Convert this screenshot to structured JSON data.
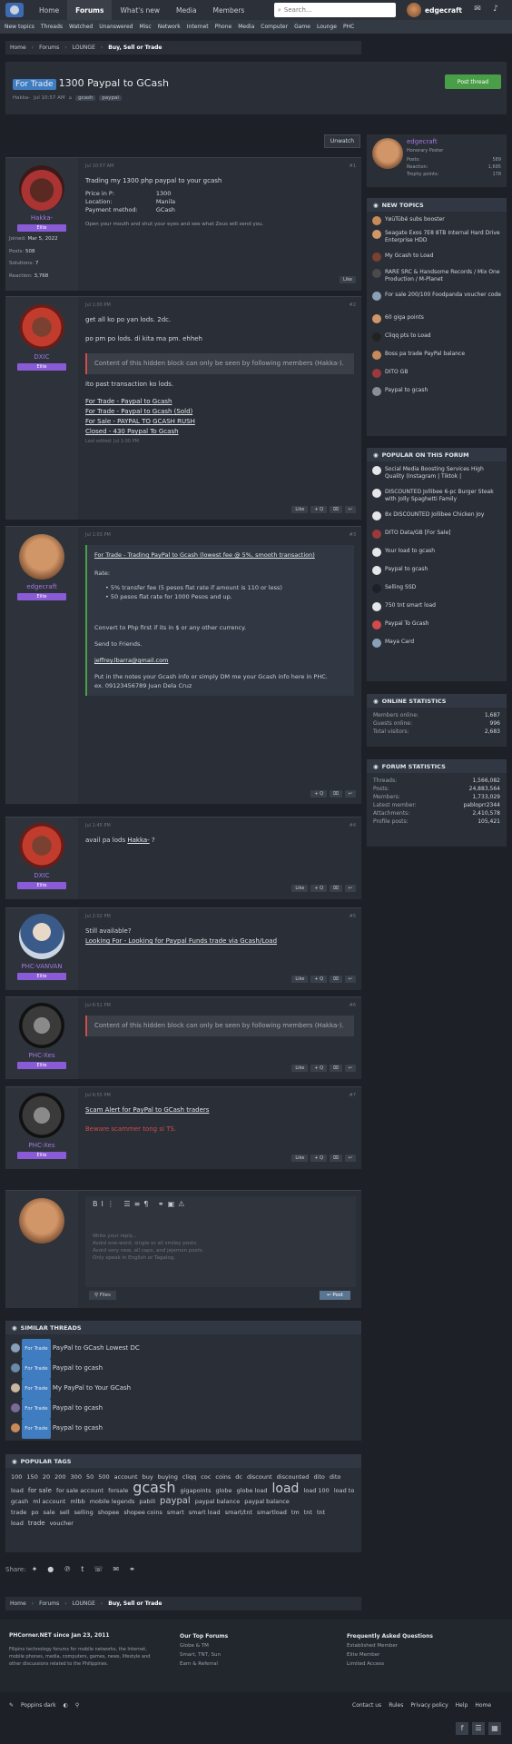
{
  "nav": {
    "tabs": [
      "Home",
      "Forums",
      "What's new",
      "Media",
      "Members"
    ],
    "search_placeholder": "Search...",
    "username": "edgecraft"
  },
  "subnav": [
    "New topics",
    "Threads",
    "Watched",
    "Unanswered",
    "Misc",
    "Network",
    "Internet",
    "Phone",
    "Media",
    "Computer",
    "Game",
    "Lounge",
    "PHC"
  ],
  "breadcrumb": [
    "Home",
    "Forums",
    "LOUNGE",
    "Buy, Sell or Trade"
  ],
  "thread": {
    "prefix": "For Trade",
    "title": "1300 Paypal to GCash",
    "author": "Hakka-",
    "date": "Jul 10:57 AM",
    "tags": [
      "gcash",
      "paypal"
    ],
    "post_button": "Post thread",
    "unwatch": "Unwatch"
  },
  "posts": [
    {
      "user": "Hakka-",
      "badge": "Elite",
      "joined_label": "Joined:",
      "joined": "Mar 5, 2022",
      "posts_label": "Posts:",
      "posts": "508",
      "solutions_label": "Solutions:",
      "solutions": "7",
      "reaction_label": "Reaction:",
      "reaction": "3,768",
      "date": "Jul 10:57 AM",
      "num": "#1",
      "lines": [
        "Trading my 1300 php paypal to your gcash"
      ],
      "fields": [
        [
          "Price in P:",
          "1300"
        ],
        [
          "Location:",
          "Manila"
        ],
        [
          "Payment method:",
          "GCash"
        ]
      ],
      "note": "Open your mouth and shut your eyes and see what Zeus will send you."
    },
    {
      "user": "DXIC",
      "badge": "Elite",
      "date": "Jul 1:00 PM",
      "num": "#2",
      "lines": [
        "get all ko po yan lods. 2dc.",
        "po pm po lods. di kita ma pm. ehheh"
      ],
      "hidden": "Content of this hidden block can only be seen by following members (Hakka-).",
      "after": "ito past transaction ko lods.",
      "links": [
        "For Trade - Paypal to Gcash",
        "For Trade - Paypal to Gcash (Sold)",
        "For Sale - PAYPAL TO GCASH RUSH",
        "Closed - 430 Paypal To Gcash"
      ],
      "edited": "Last edited: Jul 1:00 PM"
    },
    {
      "user": "edgecraft",
      "badge": "Elite",
      "date": "Jul 1:03 PM",
      "num": "#3",
      "quote_title": "For Trade - Trading PayPal to Gcash (lowest fee @ 5%, smooth transaction)",
      "rate_label": "Rate:",
      "bullets": [
        "5% transfer fee (5 pesos flat rate if amount is 110 or less)",
        "50 pesos flat rate for 1000 Pesos and up."
      ],
      "convert": "Convert to Php first if its in $ or any other currency.",
      "send": "Send to Friends.",
      "email": "jeffrey.lbarra@gmail.com",
      "put": "Put in the notes your Gcash info or simply DM me your Gcash info here in PHC.",
      "ex": "ex. 09123456789 Juan Dela Cruz"
    },
    {
      "user": "DXIC",
      "badge": "Elite",
      "date": "Jul 1:45 PM",
      "num": "#4",
      "text": "avail pa lods",
      "mention": "Hakka-",
      "q": "?"
    },
    {
      "user": "PHC-VANVAN",
      "badge": "Elite",
      "date": "Jul 2:02 PM",
      "num": "#5",
      "text": "Still available?",
      "link": "Looking For - Looking for Paypal Funds trade via Gcash/Load"
    },
    {
      "user": "PHC-Xes",
      "badge": "Elite",
      "date": "Jul 6:51 PM",
      "num": "#6",
      "hidden": "Content of this hidden block can only be seen by following members (Hakka-)."
    },
    {
      "user": "PHC-Xes",
      "badge": "Elite",
      "date": "Jul 6:55 PM",
      "num": "#7",
      "link": "Scam Alert for PayPal to GCash traders",
      "warn": "Beware scammer tong si TS."
    }
  ],
  "actions": {
    "like": "Like",
    "quote": "+ Q"
  },
  "reply": {
    "placeholder1": "Write your reply...",
    "placeholder2": "Avoid one-word, single or all smiley posts.",
    "placeholder3": "Avoid very new, all caps, and jejemon posts.",
    "placeholder4": "Only speak in English or Tagalog.",
    "files": "Files",
    "post": "Post"
  },
  "similar": {
    "title": "SIMILAR THREADS",
    "items": [
      [
        "For Trade",
        "PayPal to GCash Lowest DC"
      ],
      [
        "For Trade",
        "Paypal to gcash"
      ],
      [
        "For Trade",
        "My PayPal to Your GCash"
      ],
      [
        "For Trade",
        "Paypal to gcash"
      ],
      [
        "For Trade",
        "Paypal to gcash"
      ]
    ]
  },
  "tags": {
    "title": "POPULAR TAGS",
    "items": [
      "100",
      "150",
      "20",
      "200",
      "300",
      "50",
      "500",
      "account",
      "buy",
      "buying",
      "cliqq",
      "coc",
      "coins",
      "dc",
      "discount",
      "discounted",
      "dito",
      "dito load",
      "for sale",
      "for sale account",
      "forsale",
      "gcash",
      "gigapoints",
      "globe",
      "globe load",
      "load",
      "load 100",
      "load to gcash",
      "ml account",
      "mlbb",
      "mobile legends",
      "pabili",
      "paypal",
      "paypal balance",
      "paypal balance trade",
      "po",
      "sale",
      "sell",
      "selling",
      "shopee",
      "shopee coins",
      "smart",
      "smart load",
      "smart/tnt",
      "smartload",
      "tm",
      "tnt",
      "tnt load",
      "trade",
      "voucher"
    ]
  },
  "share": "Share:",
  "footer": {
    "brand": "PHCorner.NET since Jan 23, 2011",
    "desc": "Filipino technology forums for mobile networks, the Internet, mobile phones, media, computers, games, news, lifestyle and other discussions related to the Philippines.",
    "top_title": "Our Top Forums",
    "top": [
      "Globe & TM",
      "Smart, TNT, Sun",
      "Earn & Referral"
    ],
    "faq_title": "Frequently Asked Questions",
    "faq": [
      "Established Member",
      "Elite Member",
      "Limited Access"
    ],
    "style": "Poppins dark",
    "links": [
      "Contact us",
      "Rules",
      "Privacy policy",
      "Help",
      "Home"
    ]
  },
  "sidebar": {
    "user": {
      "name": "edgecraft",
      "title": "Honorary Poster",
      "posts_label": "Posts:",
      "posts": "589",
      "reaction_label": "Reaction:",
      "reaction": "1,695",
      "trophy_label": "Trophy points:",
      "trophy": "178"
    },
    "new_topics_title": "NEW TOPICS",
    "new_topics": [
      "YøüTübé subs booster",
      "Seagate Exos 7E8 8TB Internal Hard Drive Enterprise HDD",
      "My Gcash to Load",
      "RARE SRC & Handsome Records / Mix One Production / M-Planet",
      "For sale 200/100 Foodpanda voucher code",
      "60 giga points",
      "Cliqq pts to Load",
      "Boss pa trade PayPal balance",
      "DITO GB",
      "Paypal to gcash"
    ],
    "popular_title": "POPULAR ON THIS FORUM",
    "popular": [
      "Social Media Boosting Services High Quality (Instagram | Tiktok |",
      "DISCOUNTED Jollibee 6-pc Burger Steak with Jolly Spaghetti Family",
      "8x DISCOUNTED Jollibee Chicken Joy",
      "DITO Data/GB [For Sale]",
      "Your load to gcash",
      "Paypal to gcash",
      "Selling SSD",
      "750 tnt smart load",
      "Paypal To Gcash",
      "Maya Card"
    ],
    "online_title": "ONLINE STATISTICS",
    "online": [
      [
        "Members online:",
        "1,687"
      ],
      [
        "Guests online:",
        "996"
      ],
      [
        "Total visitors:",
        "2,683"
      ]
    ],
    "stats_title": "FORUM STATISTICS",
    "stats": [
      [
        "Threads:",
        "1,566,082"
      ],
      [
        "Posts:",
        "24,883,564"
      ],
      [
        "Members:",
        "1,733,029"
      ],
      [
        "Latest member:",
        "pabloprr2344"
      ],
      [
        "Attachments:",
        "2,410,578"
      ],
      [
        "Profile posts:",
        "105,421"
      ]
    ]
  },
  "colors": {
    "bg": "#1d2127",
    "panel": "#2a2f37",
    "accent": "#3f7cc0",
    "green": "#4a9e47",
    "purple": "#a478e1",
    "red": "#d14b4b"
  }
}
